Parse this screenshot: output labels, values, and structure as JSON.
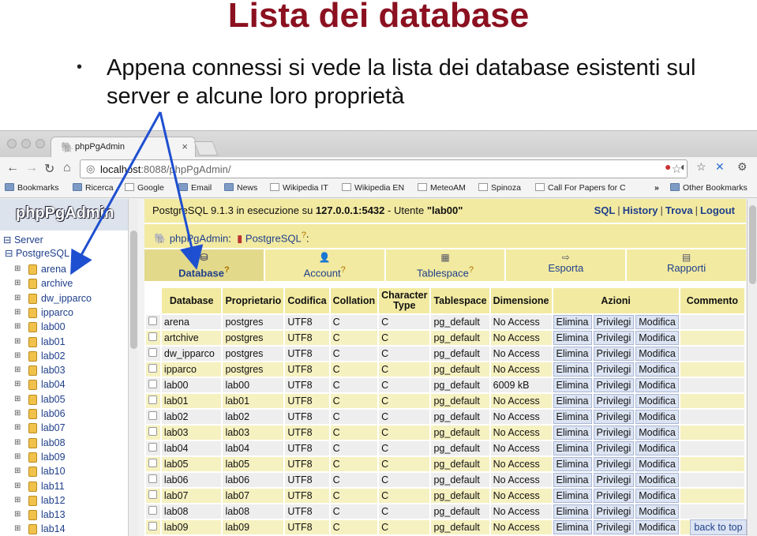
{
  "slide": {
    "title": "Lista dei database",
    "bullet": "Appena connessi si vede la lista dei database esistenti sul server e alcune loro proprietà"
  },
  "browser": {
    "tab_title": "phpPgAdmin",
    "url_host": "localhost",
    "url_rest": ":8088/phpPgAdmin/",
    "bookmarks": [
      "Bookmarks",
      "Ricerca",
      "Google",
      "Email",
      "News",
      "Wikipedia IT",
      "Wikipedia EN",
      "MeteoAM",
      "Spinoza",
      "Call For Papers for C",
      "»",
      "Other Bookmarks"
    ]
  },
  "tree": {
    "logo": "phpPgAdmin",
    "server_label": "Server",
    "pg_label": "PostgreSQL",
    "items": [
      "arena",
      "archive",
      "dw_ipparco",
      "ipparco",
      "lab00",
      "lab01",
      "lab02",
      "lab03",
      "lab04",
      "lab05",
      "lab06",
      "lab07",
      "lab08",
      "lab09",
      "lab10",
      "lab11",
      "lab12",
      "lab13",
      "lab14"
    ]
  },
  "main": {
    "status_prefix": "PostgreSQL 9.1.3 in esecuzione su ",
    "status_host": "127.0.0.1:5432",
    "status_mid": " - Utente ",
    "status_user": "\"lab00\"",
    "links": [
      "SQL",
      "History",
      "Trova",
      "Logout"
    ],
    "crumb_app": "phpPgAdmin",
    "crumb_server": "PostgreSQL",
    "tabs": [
      "Database",
      "Account",
      "Tablespace",
      "Esporta",
      "Rapporti"
    ],
    "columns": [
      "Database",
      "Proprietario",
      "Codifica",
      "Collation",
      "Character Type",
      "Tablespace",
      "Dimensione",
      "Azioni",
      "Commento"
    ],
    "actions": [
      "Elimina",
      "Privilegi",
      "Modifica"
    ],
    "rows": [
      [
        "arena",
        "postgres",
        "UTF8",
        "C",
        "C",
        "pg_default",
        "No Access"
      ],
      [
        "artchive",
        "postgres",
        "UTF8",
        "C",
        "C",
        "pg_default",
        "No Access"
      ],
      [
        "dw_ipparco",
        "postgres",
        "UTF8",
        "C",
        "C",
        "pg_default",
        "No Access"
      ],
      [
        "ipparco",
        "postgres",
        "UTF8",
        "C",
        "C",
        "pg_default",
        "No Access"
      ],
      [
        "lab00",
        "lab00",
        "UTF8",
        "C",
        "C",
        "pg_default",
        "6009 kB"
      ],
      [
        "lab01",
        "lab01",
        "UTF8",
        "C",
        "C",
        "pg_default",
        "No Access"
      ],
      [
        "lab02",
        "lab02",
        "UTF8",
        "C",
        "C",
        "pg_default",
        "No Access"
      ],
      [
        "lab03",
        "lab03",
        "UTF8",
        "C",
        "C",
        "pg_default",
        "No Access"
      ],
      [
        "lab04",
        "lab04",
        "UTF8",
        "C",
        "C",
        "pg_default",
        "No Access"
      ],
      [
        "lab05",
        "lab05",
        "UTF8",
        "C",
        "C",
        "pg_default",
        "No Access"
      ],
      [
        "lab06",
        "lab06",
        "UTF8",
        "C",
        "C",
        "pg_default",
        "No Access"
      ],
      [
        "lab07",
        "lab07",
        "UTF8",
        "C",
        "C",
        "pg_default",
        "No Access"
      ],
      [
        "lab08",
        "lab08",
        "UTF8",
        "C",
        "C",
        "pg_default",
        "No Access"
      ],
      [
        "lab09",
        "lab09",
        "UTF8",
        "C",
        "C",
        "pg_default",
        "No Access"
      ]
    ],
    "back_to_top": "back to top"
  },
  "colors": {
    "title": "#8b1020",
    "header_bg": "#f2eaa1",
    "link": "#1f3f8a",
    "arrow": "#1e4fd0"
  }
}
